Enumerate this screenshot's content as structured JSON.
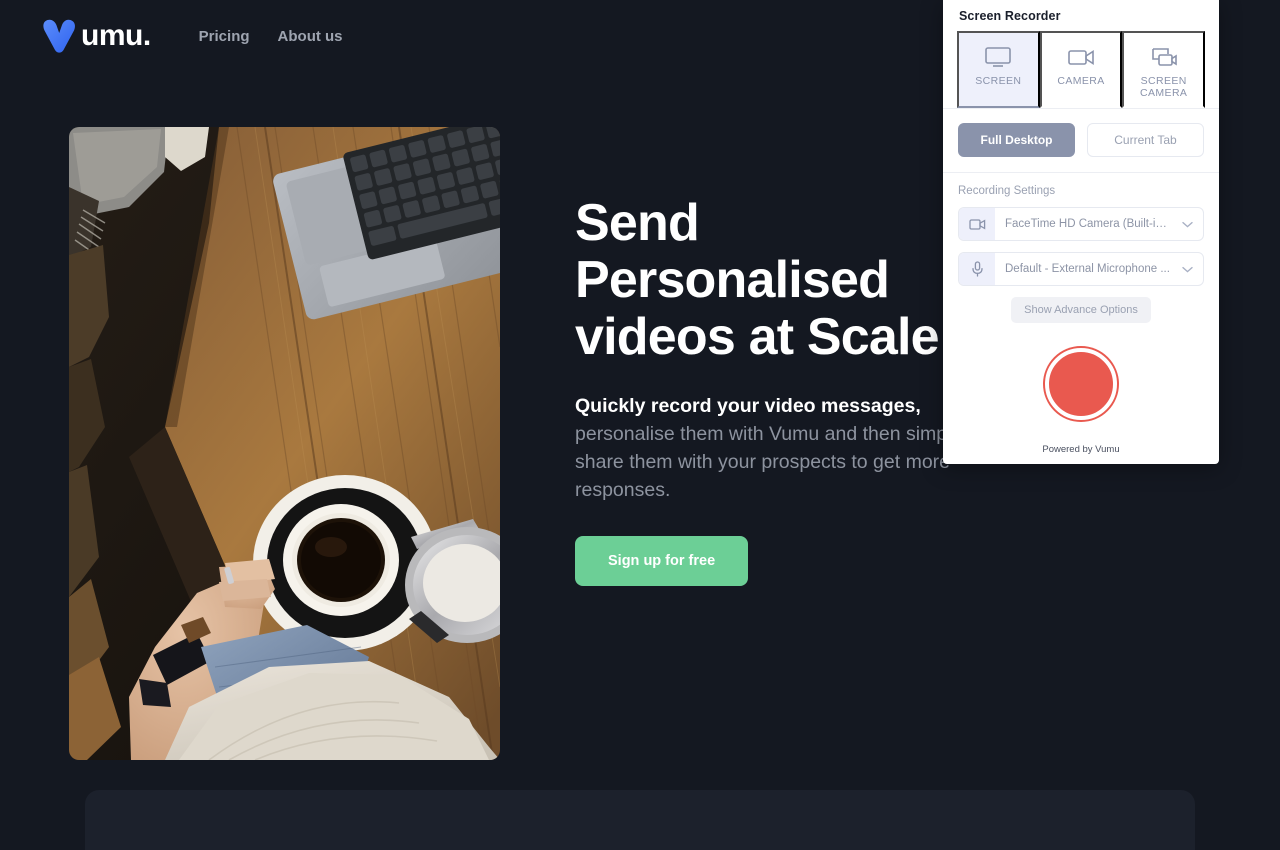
{
  "brand": {
    "logo_icon": "vumu-v-logo-icon",
    "logo_word": "umu.",
    "accent_blue": "#3b6ff5",
    "accent_green": "#6ccf96",
    "record_red": "#e9594f",
    "page_bg": "#141821"
  },
  "nav": {
    "links": [
      {
        "label": "Pricing"
      },
      {
        "label": "About us"
      }
    ]
  },
  "hero": {
    "headline": "Send\nPersonalised\nvideos at Scale",
    "subhead_strong": "Quickly record your video messages,",
    "subhead_rest": " personalise them with Vumu and then simply share them with your prospects to get more responses.",
    "cta_label": "Sign up for free",
    "image_alt": "overhead photo of a wooden cafe table with a laptop, cup of black coffee and a milk jug, person's arm with a watch resting nearby"
  },
  "recorder": {
    "title": "Screen Recorder",
    "modes": [
      {
        "label": "SCREEN",
        "icon": "monitor-icon",
        "active": true
      },
      {
        "label": "CAMERA",
        "icon": "video-camera-icon",
        "active": false
      },
      {
        "label": "SCREEN\nCAMERA",
        "icon": "screen-camera-icon",
        "active": false
      }
    ],
    "sources": [
      {
        "label": "Full Desktop",
        "active": true
      },
      {
        "label": "Current Tab",
        "active": false
      }
    ],
    "settings_label": "Recording Settings",
    "selects": [
      {
        "icon": "video-camera-icon",
        "value": "FaceTime HD Camera (Built-in)...",
        "chevron": "chevron-down-icon"
      },
      {
        "icon": "microphone-icon",
        "value": "Default - External Microphone ...",
        "chevron": "chevron-down-icon"
      }
    ],
    "advance_label": "Show Advance Options",
    "record_button_name": "record-button",
    "footer": "Powered by Vumu"
  }
}
